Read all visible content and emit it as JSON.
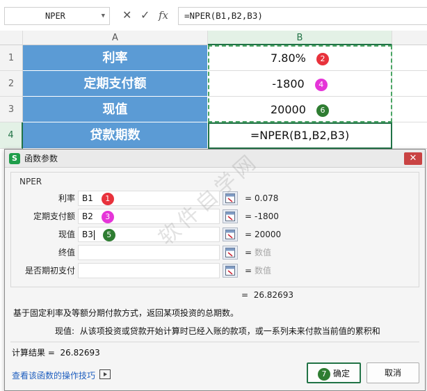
{
  "formula_bar": {
    "name_box": "NPER",
    "icons": [
      "cancel-x-icon",
      "confirm-check-icon",
      "fx-icon"
    ],
    "formula": "=NPER(B1,B2,B3)"
  },
  "sheet": {
    "columns": [
      "A",
      "B"
    ],
    "rows": [
      {
        "num": "1",
        "a": "利率",
        "b": "7.80%",
        "badge": "2",
        "badge_color": "#e8323c"
      },
      {
        "num": "2",
        "a": "定期支付额",
        "b": "-1800",
        "badge": "4",
        "badge_color": "#e535d8"
      },
      {
        "num": "3",
        "a": "现值",
        "b": "20000",
        "badge": "6",
        "badge_color": "#2f7d32"
      },
      {
        "num": "4",
        "a": "贷款期数",
        "b": "=NPER(B1,B2,B3)"
      }
    ]
  },
  "dialog": {
    "title": "函数参数",
    "function_name": "NPER",
    "args": [
      {
        "label": "利率",
        "value": "B1",
        "badge": "1",
        "result": "0.078"
      },
      {
        "label": "定期支付额",
        "value": "B2",
        "badge": "3",
        "result": "-1800"
      },
      {
        "label": "现值",
        "value": "B3",
        "badge": "5",
        "result": "20000"
      },
      {
        "label": "终值",
        "value": "",
        "result": "数值"
      },
      {
        "label": "是否期初支付",
        "value": "",
        "result": "数值"
      }
    ],
    "eq": "=",
    "formula_result": "26.82693",
    "description": "基于固定利率及等额分期付款方式，返回某项投资的总期数。",
    "param_name": "现值:",
    "param_description": "从该项投资或贷款开始计算时已经入账的款项，或一系列未来付款当前值的累积和",
    "calc_label": "计算结果 =",
    "calc_value": "26.82693",
    "help_link": "查看该函数的操作技巧",
    "ok_badge": "7",
    "ok_label": "确定",
    "cancel_label": "取消"
  },
  "watermark": "软件自学网"
}
